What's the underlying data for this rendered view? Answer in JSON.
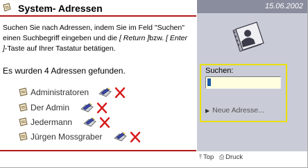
{
  "header": {
    "title": "System- Adressen",
    "date": "15.06.2002"
  },
  "description": {
    "part1": "Suchen Sie nach Adressen, indem Sie im Feld \"Suchen\" einen Suchbegriff eingeben und die ",
    "return_key": "[ Return ]",
    "part2": "bzw. ",
    "enter_key": "[ Enter ]",
    "part3": "-Taste auf Ihrer Tastatur betätigen."
  },
  "result_text": "Es wurden 4 Adressen gefunden.",
  "addresses": [
    {
      "name": "Administratoren"
    },
    {
      "name": "Der Admin"
    },
    {
      "name": "Jedermann"
    },
    {
      "name": "Jürgen Mossgraber"
    }
  ],
  "search": {
    "label": "Suchen:",
    "value": "",
    "placeholder": ""
  },
  "new_address_label": "Neue Adresse...",
  "footer": {
    "top_label": "Top",
    "print_label": "Druck"
  },
  "icons": {
    "header": "vcard-icon",
    "panel": "address-book-icon",
    "edit": "edit-icon",
    "delete": "delete-icon"
  },
  "colors": {
    "accent_red": "#b01818",
    "panel": "#c9cbd6",
    "date_bar": "#8a8d9e",
    "highlight": "#e8e000"
  }
}
